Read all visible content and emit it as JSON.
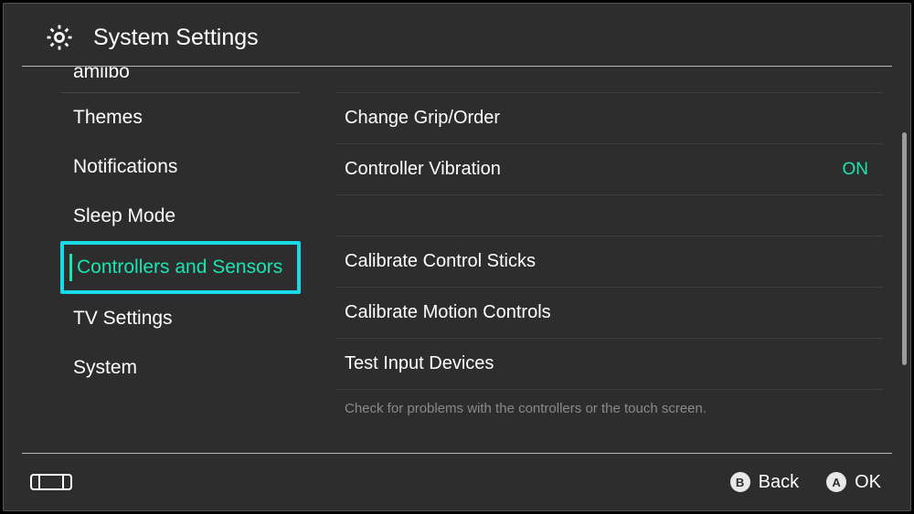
{
  "header": {
    "title": "System Settings"
  },
  "sidebar": {
    "truncated_top": "amiibo",
    "items": [
      {
        "label": "Themes",
        "selected": false
      },
      {
        "label": "Notifications",
        "selected": false
      },
      {
        "label": "Sleep Mode",
        "selected": false
      },
      {
        "label": "Controllers and Sensors",
        "selected": true
      },
      {
        "label": "TV Settings",
        "selected": false
      },
      {
        "label": "System",
        "selected": false
      }
    ]
  },
  "main": {
    "group1": [
      {
        "label": "Change Grip/Order",
        "value": ""
      },
      {
        "label": "Controller Vibration",
        "value": "ON"
      }
    ],
    "group2": [
      {
        "label": "Calibrate Control Sticks",
        "value": ""
      },
      {
        "label": "Calibrate Motion Controls",
        "value": ""
      },
      {
        "label": "Test Input Devices",
        "value": ""
      }
    ],
    "hint": "Check for problems with the controllers or the touch screen."
  },
  "footer": {
    "back": {
      "glyph": "B",
      "label": "Back"
    },
    "ok": {
      "glyph": "A",
      "label": "OK"
    }
  },
  "colors": {
    "accent": "#18e6b0",
    "selection_border": "#18d9e6",
    "bg": "#2d2d2d"
  }
}
